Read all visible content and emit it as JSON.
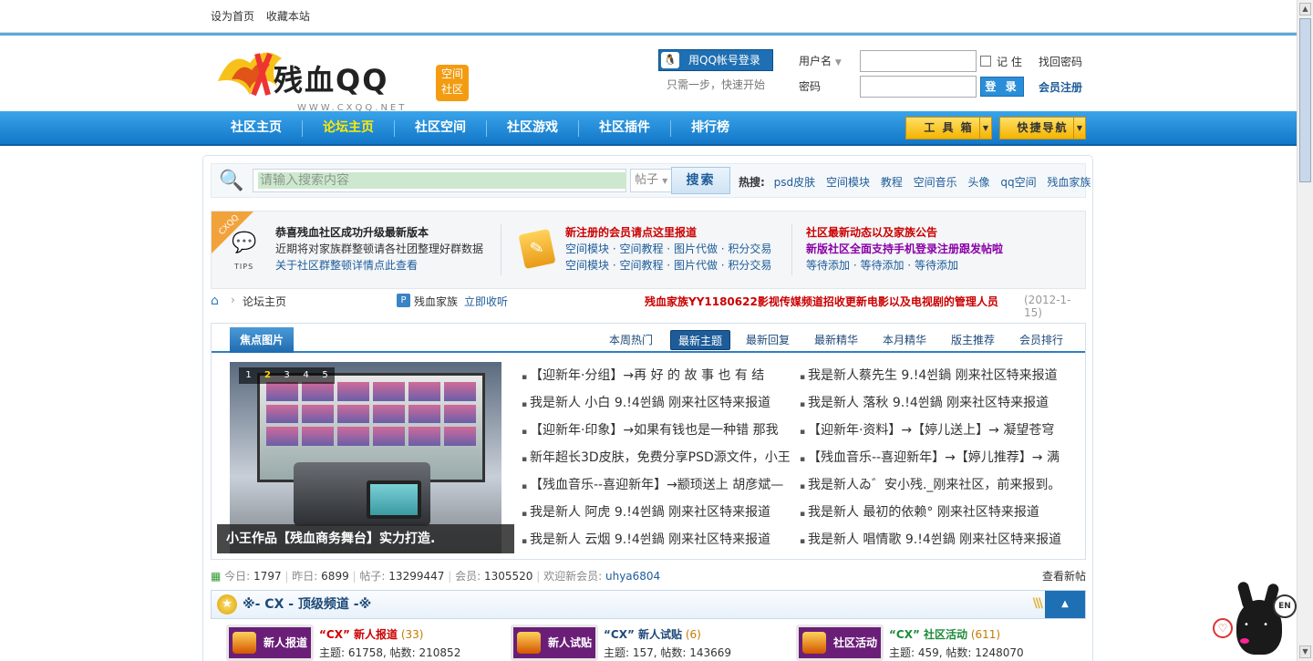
{
  "topbar": {
    "set_home": "设为首页",
    "bookmark": "收藏本站"
  },
  "logo": {
    "text": "残血QQ",
    "badge_line1": "空间",
    "badge_line2": "社区",
    "url": "WWW.CXQQ.NET"
  },
  "qq": {
    "login_label": "用QQ帐号登录",
    "hint": "只需一步，快速开始",
    "icon": "penguin-icon"
  },
  "login": {
    "username_label": "用户名",
    "password_label": "密码",
    "remember_label": "记 住",
    "find_password": "找回密码",
    "submit": "登 录",
    "register": "会员注册"
  },
  "nav": {
    "items": [
      {
        "label": "社区主页"
      },
      {
        "label": "论坛主页"
      },
      {
        "label": "社区空间"
      },
      {
        "label": "社区游戏"
      },
      {
        "label": "社区插件"
      },
      {
        "label": "排行榜"
      }
    ],
    "active_index": 1,
    "toolbox": "工 具 箱",
    "quicknav": "快捷导航"
  },
  "search": {
    "placeholder": "请输入搜索内容",
    "type": "帖子",
    "button": "搜索",
    "hot_label": "热搜:",
    "hot": [
      "psd皮肤",
      "空间模块",
      "教程",
      "空间音乐",
      "头像",
      "qq空间",
      "残血家族"
    ]
  },
  "notice": {
    "tips_tag": "CXQQ",
    "tips_label": "TIPS",
    "col1": {
      "title": "恭喜残血社区成功升级最新版本",
      "line1": "近期将对家族群整顿请各社团整理好群数据",
      "line2": "关于社区群整顿详情点此查看"
    },
    "col2": {
      "title": "新注册的会员请点这里报道",
      "row1": [
        "空间模块",
        "空间教程",
        "图片代做",
        "积分交易"
      ],
      "row2": [
        "空间模块",
        "空间教程",
        "图片代做",
        "积分交易"
      ]
    },
    "col3": {
      "title": "社区最新动态以及家族公告",
      "line1": "新版社区全面支持手机登录注册跟发帖啦",
      "row": [
        "等待添加",
        "等待添加",
        "等待添加"
      ]
    }
  },
  "breadcrumb": {
    "current": "论坛主页",
    "family": "残血家族",
    "collect": "立即收听",
    "announcement": "残血家族YY1180622影视传媒频道招收更新电影以及电视剧的管理人员",
    "date": "(2012-1-15)"
  },
  "panel": {
    "focus_tab": "焦点图片",
    "tabs": [
      "本周热门",
      "最新主题",
      "最新回复",
      "最新精华",
      "本月精华",
      "版主推荐",
      "会员排行"
    ],
    "active_tab": 1,
    "slide_numbers": [
      "1",
      "2",
      "3",
      "4",
      "5"
    ],
    "slide_active": 1,
    "caption": "小王作品【残血商务舞台】实力打造.",
    "left_list": [
      "【迎新年·分组】→再 好 的 故 事 也 有 结",
      "我是新人 小白 9.!4쒼鍋 刚来社区特来报道",
      "【迎新年·印象】→如果有钱也是一种错 那我",
      "新年超长3D皮肤，免费分享PSD源文件，小王",
      "【残血音乐--喜迎新年】→颛顼送上 胡彦斌—",
      "我是新人 阿虎 9.!4쒼鍋 刚来社区特来报道",
      "我是新人 云烟 9.!4쒼鍋 刚来社区特来报道"
    ],
    "right_list": [
      "我是新人蔡先生 9.!4쒼鍋 刚来社区特来报道",
      "我是新人 落秋 9.!4쒼鍋 刚来社区特来报道",
      "【迎新年·资料】→【婷儿送上】→ 凝望苍穹",
      "【残血音乐--喜迎新年】→【婷儿推荐】→ 满",
      "我是新人ゐ゛安小残._刚来社区，前来报到。",
      "我是新人 最初的依赖° 刚来社区特来报道",
      "我是新人 唱情歌 9.!4쒼鍋 刚来社区特来报道"
    ]
  },
  "stats": {
    "today_label": "今日:",
    "today": "1797",
    "yesterday_label": "昨日:",
    "yesterday": "6899",
    "posts_label": "帖子:",
    "posts": "13299447",
    "members_label": "会员:",
    "members": "1305520",
    "welcome": "欢迎新会员:",
    "newest": "uhya6804",
    "view_new": "查看新帖"
  },
  "channel": {
    "title": "※- CX - 顶级频道 -※"
  },
  "forums": [
    {
      "icon_label": "新人报道",
      "name": "“CX” 新人报道",
      "count": "(33)",
      "meta": "主题: 61758, 帖数: 210852"
    },
    {
      "icon_label": "新人试贴",
      "name": "“CX” 新人试贴",
      "count": "(6)",
      "meta": "主题: 157, 帖数: 143669"
    },
    {
      "icon_label": "社区活动",
      "name": "“CX” 社区活动",
      "count": "(611)",
      "meta": "主题: 459, 帖数: 1248070"
    }
  ],
  "mascot": {
    "en": "EN"
  }
}
